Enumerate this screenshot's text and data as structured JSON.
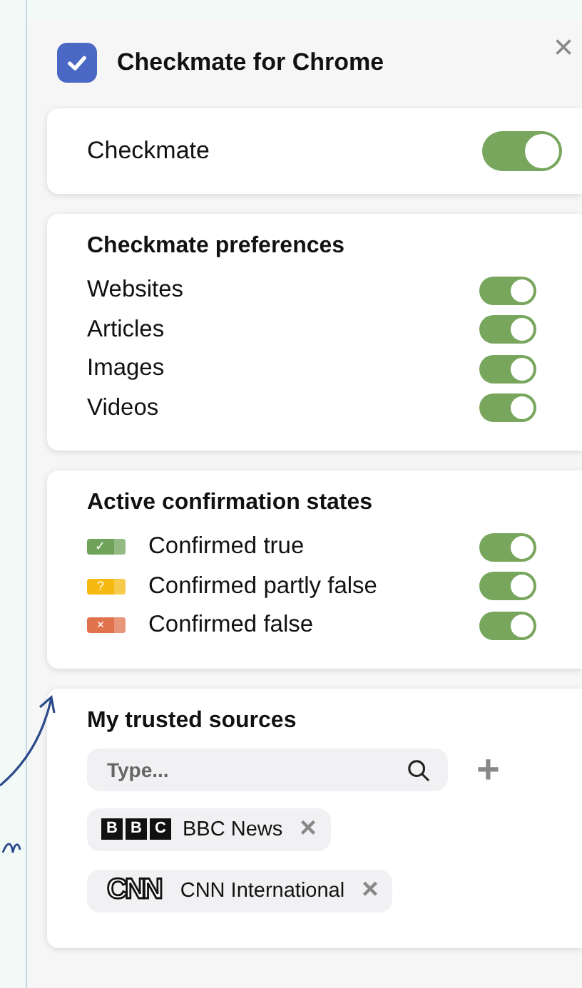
{
  "header": {
    "title": "Checkmate for Chrome",
    "close": "×",
    "checked": true
  },
  "main_toggle": {
    "label": "Checkmate",
    "on": true
  },
  "preferences": {
    "title": "Checkmate preferences",
    "items": [
      {
        "label": "Websites",
        "on": true
      },
      {
        "label": "Articles",
        "on": true
      },
      {
        "label": "Images",
        "on": true
      },
      {
        "label": "Videos",
        "on": true
      }
    ]
  },
  "states": {
    "title": "Active confirmation states",
    "items": [
      {
        "label": "Confirmed true",
        "symbol": "✓",
        "color": "#6fa35a",
        "on": true
      },
      {
        "label": "Confirmed partly false",
        "symbol": "?",
        "color": "#f5b90f",
        "on": true
      },
      {
        "label": "Confirmed false",
        "symbol": "×",
        "color": "#e0734c",
        "on": true
      }
    ]
  },
  "trusted_sources": {
    "title": "My trusted sources",
    "search": {
      "placeholder": "Type..."
    },
    "add": "+",
    "sources": [
      {
        "kind": "boxed",
        "logo": [
          "B",
          "B",
          "C"
        ],
        "name": "BBC News",
        "remove": "×"
      },
      {
        "kind": "outline",
        "logo": [
          "CNN"
        ],
        "name": "CNN International",
        "remove": "×"
      }
    ]
  }
}
